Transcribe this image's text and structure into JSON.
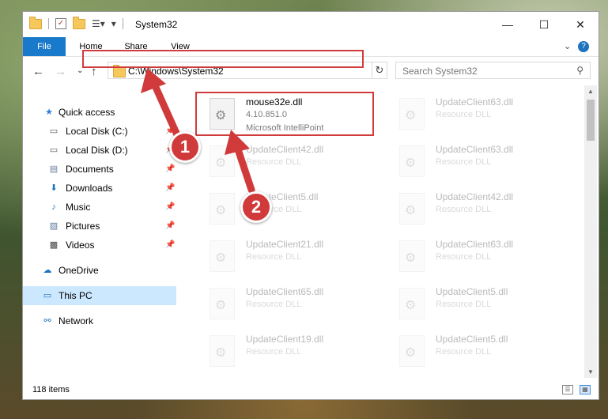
{
  "window": {
    "title": "System32",
    "minimize": "—",
    "maximize": "☐",
    "close": "✕"
  },
  "ribbon": {
    "tabs": [
      "File",
      "Home",
      "Share",
      "View"
    ],
    "expand": "⌄",
    "help": "?"
  },
  "address": {
    "path": "C:\\Windows\\System32",
    "refresh": "↻"
  },
  "search": {
    "placeholder": "Search System32",
    "icon": "⚲"
  },
  "sidebar": {
    "items": [
      {
        "label": "Quick access",
        "icon": "★"
      },
      {
        "label": "Local Disk (C:)",
        "icon": "▭"
      },
      {
        "label": "Local Disk (D:)",
        "icon": "▭"
      },
      {
        "label": "Documents",
        "icon": "▤"
      },
      {
        "label": "Downloads",
        "icon": "⬇"
      },
      {
        "label": "Music",
        "icon": "♪"
      },
      {
        "label": "Pictures",
        "icon": "▨"
      },
      {
        "label": "Videos",
        "icon": "▩"
      },
      {
        "label": "OneDrive",
        "icon": "☁"
      },
      {
        "label": "This PC",
        "icon": "▭"
      },
      {
        "label": "Network",
        "icon": "⚯"
      }
    ],
    "pin": "📌"
  },
  "files": [
    {
      "name": "mouse32e.dll",
      "line1": "4.10.851.0",
      "line2": "Microsoft IntelliPoint"
    },
    {
      "name": "UpdateClient63.dll",
      "line1": "Resource DLL",
      "line2": ""
    },
    {
      "name": "UpdateClient42.dll",
      "line1": "Resource DLL",
      "line2": ""
    },
    {
      "name": "UpdateClient63.dll",
      "line1": "Resource DLL",
      "line2": ""
    },
    {
      "name": "UpdateClient5.dll",
      "line1": "Resource DLL",
      "line2": ""
    },
    {
      "name": "UpdateClient42.dll",
      "line1": "Resource DLL",
      "line2": ""
    },
    {
      "name": "UpdateClient21.dll",
      "line1": "Resource DLL",
      "line2": ""
    },
    {
      "name": "UpdateClient63.dll",
      "line1": "Resource DLL",
      "line2": ""
    },
    {
      "name": "UpdateClient65.dll",
      "line1": "Resource DLL",
      "line2": ""
    },
    {
      "name": "UpdateClient5.dll",
      "line1": "Resource DLL",
      "line2": ""
    },
    {
      "name": "UpdateClient19.dll",
      "line1": "Resource DLL",
      "line2": ""
    },
    {
      "name": "UpdateClient5.dll",
      "line1": "Resource DLL",
      "line2": ""
    }
  ],
  "status": {
    "items_count": "118 items"
  },
  "annotations": {
    "badge1": "1",
    "badge2": "2",
    "color": "#d13a3a"
  }
}
